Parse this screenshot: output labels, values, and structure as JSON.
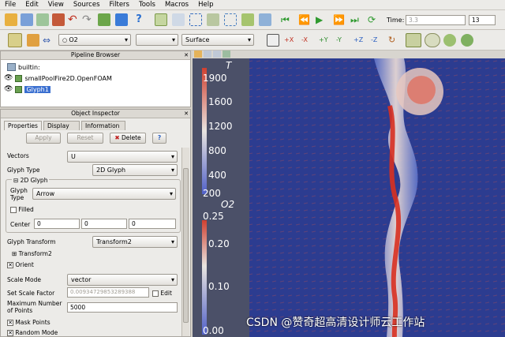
{
  "menubar": [
    "File",
    "Edit",
    "View",
    "Sources",
    "Filters",
    "Tools",
    "Macros",
    "Help"
  ],
  "toolbar": {
    "time_label": "Time:",
    "time_value": "3.3",
    "time_index": "13",
    "active_array": "O2",
    "representation": "Surface"
  },
  "pipeline_browser": {
    "title": "Pipeline Browser",
    "items": [
      "builtin:",
      "smallPoolFire2D.OpenFOAM",
      "Glyph1"
    ]
  },
  "object_inspector": {
    "title": "Object Inspector",
    "tabs": [
      "Properties",
      "Display",
      "Information"
    ],
    "apply": "Apply",
    "reset": "Reset",
    "delete": "Delete",
    "help": "?",
    "vectors_label": "Vectors",
    "vectors_value": "U",
    "glyph_type_label": "Glyph Type",
    "glyph_type_value": "2D Glyph",
    "group_2d_glyph": "2D Glyph",
    "glyph_type2_label": "Glyph Type",
    "glyph_type2_value": "Arrow",
    "filled_label": "Filled",
    "center_label": "Center",
    "center": [
      "0",
      "0",
      "0"
    ],
    "glyph_transform_label": "Glyph Transform",
    "glyph_transform_value": "Transform2",
    "transform2_label": "Transform2",
    "orient_label": "Orient",
    "scale_mode_label": "Scale Mode",
    "scale_mode_value": "vector",
    "scale_factor_label": "Set Scale Factor",
    "scale_factor_value": "0.00934729853289388",
    "edit_label": "Edit",
    "max_points_label": "Maximum Number of Points",
    "max_points_value": "5000",
    "mask_points_label": "Mask Points",
    "random_mode_label": "Random Mode"
  },
  "legend_T": {
    "title": "T",
    "ticks": [
      "1900",
      "1600",
      "1200",
      "800",
      "400",
      "200"
    ]
  },
  "legend_O2": {
    "title": "O2",
    "ticks": [
      "0.25",
      "0.20",
      "0.10",
      "0.00"
    ]
  },
  "watermark": "CSDN @赞奇超高清设计师云工作站",
  "colors": {
    "background": "#2a3a8e",
    "accent": "#d04030"
  }
}
